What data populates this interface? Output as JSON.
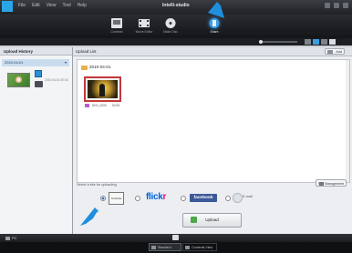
{
  "window": {
    "title": "Intelli-studio",
    "menu": [
      "File",
      "Edit",
      "View",
      "Tool",
      "Help"
    ]
  },
  "toolbar": {
    "buttons": [
      {
        "label": "Contents",
        "active": false
      },
      {
        "label": "Movie Editor",
        "active": false
      },
      {
        "label": "Make Disc",
        "active": false
      },
      {
        "label": "Share",
        "active": true
      }
    ]
  },
  "left_panel": {
    "header": "Upload History",
    "date_group": "2010-04-01",
    "item_meta": "2010.04.01 00:00"
  },
  "main": {
    "header": "Upload List",
    "add_button": "Add",
    "folder": "2010-04-01",
    "clip_label": "SNV_0000",
    "clip_duration": "00:05",
    "hint": "Select a site for uploading.",
    "management_button": "Site Management",
    "sites": [
      {
        "label": "YouTube",
        "selected": true
      },
      {
        "label": "flickr",
        "selected": false
      },
      {
        "label": "facebook",
        "selected": false
      },
      {
        "label": "E-mail",
        "selected": false
      }
    ],
    "upload_button": "Upload"
  },
  "status": {
    "location": "PC"
  },
  "bottom_tabs": [
    {
      "label": "Standard",
      "active": true
    },
    {
      "label": "Contents View",
      "active": false
    }
  ],
  "colors": {
    "accent": "#2e9ee8",
    "highlight_arrow": "#1f8fdc",
    "facebook": "#3b5998",
    "flickr_blue": "#0063dc",
    "flickr_pink": "#ff0084"
  }
}
